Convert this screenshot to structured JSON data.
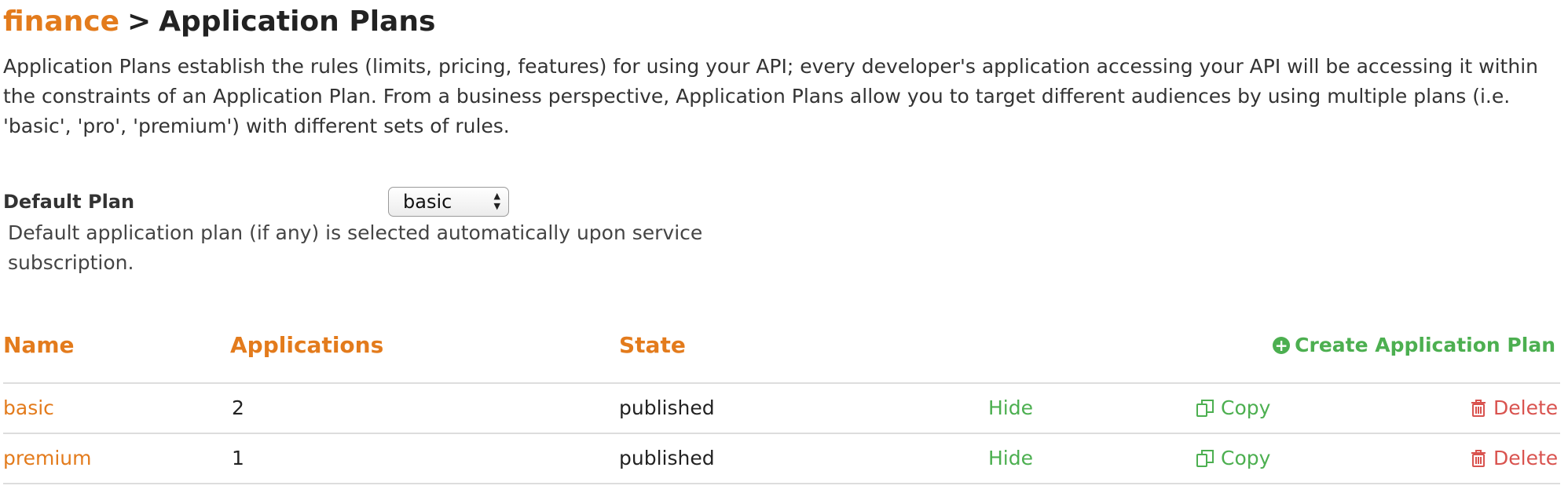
{
  "breadcrumb": {
    "service": "finance",
    "separator": ">",
    "current": "Application Plans"
  },
  "intro": "Application Plans establish the rules (limits, pricing, features) for using your API; every developer's application accessing your API will be accessing it within the constraints of an Application Plan. From a business perspective, Application Plans allow you to target different audiences by using multiple plans (i.e. 'basic', 'pro', 'premium') with different sets of rules.",
  "default_plan": {
    "label": "Default Plan",
    "selected": "basic",
    "hint": "Default application plan (if any) is selected automatically upon service subscription."
  },
  "table": {
    "headers": {
      "name": "Name",
      "applications": "Applications",
      "state": "State"
    },
    "create_label": "Create Application Plan",
    "rows": [
      {
        "name": "basic",
        "applications": "2",
        "state": "published",
        "hide": "Hide",
        "copy": "Copy",
        "delete": "Delete"
      },
      {
        "name": "premium",
        "applications": "1",
        "state": "published",
        "hide": "Hide",
        "copy": "Copy",
        "delete": "Delete"
      }
    ]
  },
  "colors": {
    "accent_orange": "#e37b1c",
    "action_green": "#4caf50",
    "danger_red": "#d9534f"
  },
  "icons": {
    "create": "plus-circle-icon",
    "copy": "copy-icon",
    "delete": "trash-icon",
    "select": "select-arrows-icon"
  }
}
